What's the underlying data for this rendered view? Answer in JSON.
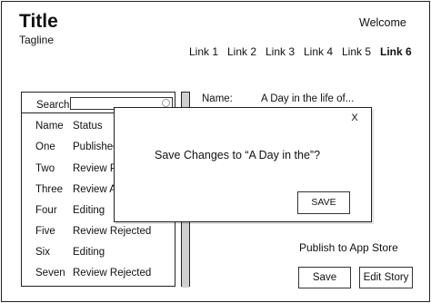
{
  "header": {
    "title": "Title",
    "tagline": "Tagline",
    "welcome": "Welcome"
  },
  "nav": {
    "links": [
      "Link 1",
      "Link 2",
      "Link 3",
      "Link 4",
      "Link 5",
      "Link 6"
    ],
    "active": "Link 6"
  },
  "search": {
    "label": "Search",
    "value": "",
    "placeholder": ""
  },
  "list": {
    "columns": [
      "Name",
      "Status"
    ],
    "rows": [
      {
        "name": "One",
        "status": "Published"
      },
      {
        "name": "Two",
        "status": "Review Pe"
      },
      {
        "name": "Three",
        "status": "Review Ap"
      },
      {
        "name": "Four",
        "status": "Editing"
      },
      {
        "name": "Five",
        "status": "Review Rejected"
      },
      {
        "name": "Six",
        "status": "Editing"
      },
      {
        "name": "Seven",
        "status": "Review Rejected"
      }
    ]
  },
  "detail": {
    "name_label": "Name:",
    "name_value": "A Day in the life of...",
    "publish_label": "Publish to App Store",
    "save_label": "Save",
    "edit_label": "Edit Story"
  },
  "modal": {
    "close_label": "X",
    "message": "Save Changes to “A Day in the”?",
    "save_label": "SAVE"
  }
}
